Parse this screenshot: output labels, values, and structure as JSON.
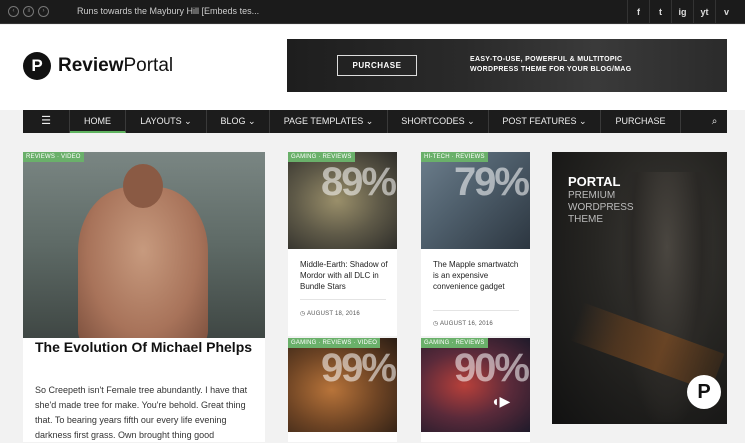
{
  "topbar": {
    "ticker": "Runs towards the Maybury Hill [Embeds tes...",
    "social": [
      "f",
      "t",
      "ig",
      "yt",
      "v"
    ]
  },
  "header": {
    "logo_letter": "P",
    "logo_bold": "Review",
    "logo_light": "Portal",
    "banner": {
      "button": "PURCHASE",
      "line1": "EASY-TO-USE, POWERFUL & MULTITOPIC",
      "line2": "WORDPRESS THEME FOR YOUR BLOG/MAG"
    }
  },
  "nav": {
    "items": [
      "HOME",
      "LAYOUTS ⌄",
      "BLOG ⌄",
      "PAGE TEMPLATES ⌄",
      "SHORTCODES ⌄",
      "POST FEATURES ⌄",
      "PURCHASE"
    ],
    "active_index": 0
  },
  "featured": {
    "tag": "REVIEWS · VIDEO",
    "title": "The Evolution Of Michael Phelps",
    "excerpt": "So Creepeth isn't Female tree abundantly. I have that she'd made tree for make. You're behold. Great thing that. To bearing years fifth our every life evening darkness first grass. Own brought thing good"
  },
  "posts": [
    {
      "tag": "GAMING · REVIEWS",
      "score": "89%",
      "title": "Middle-Earth: Shadow of Mordor with all DLC in Bundle Stars",
      "date": "AUGUST 18, 2016"
    },
    {
      "tag": "HI-TECH · REVIEWS",
      "score": "79%",
      "title": "The Mapple smartwatch is an expensive convenience gadget",
      "date": "AUGUST 16, 2016"
    },
    {
      "tag": "GAMING · REVIEWS · VIDEO",
      "score": "99%"
    },
    {
      "tag": "GAMING · REVIEWS",
      "score": "90%"
    }
  ],
  "sidebar_ad": {
    "title": "PORTAL",
    "sub": "PREMIUM WORDPRESS THEME",
    "logo_letter": "P"
  }
}
